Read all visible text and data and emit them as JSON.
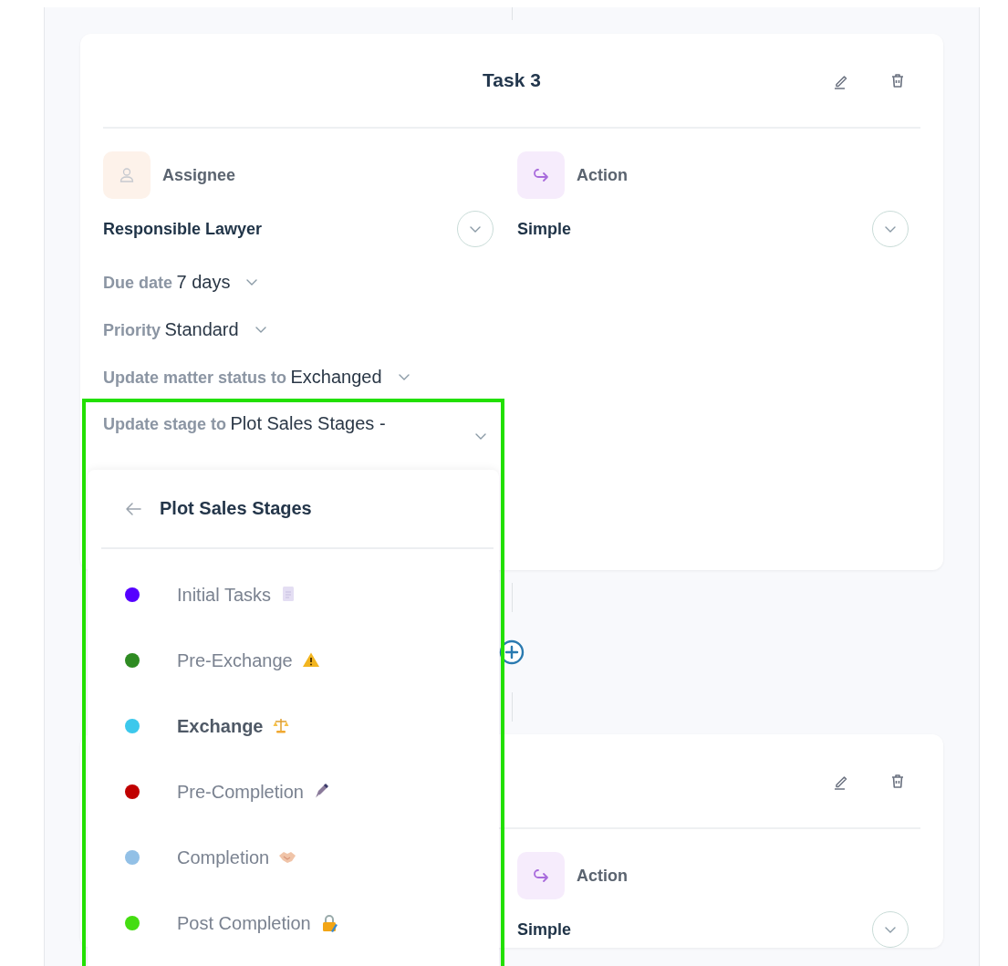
{
  "cards": [
    {
      "title": "Task 3",
      "assignee": {
        "label": "Assignee",
        "value": "Responsible Lawyer"
      },
      "action": {
        "label": "Action",
        "value": "Simple"
      },
      "fields": [
        {
          "label": "Due date",
          "value": "7 days"
        },
        {
          "label": "Priority",
          "value": "Standard"
        },
        {
          "label": "Update matter status to",
          "value": "Exchanged"
        },
        {
          "label": "Update stage to",
          "value": "Plot Sales Stages -"
        }
      ]
    },
    {
      "action": {
        "label": "Action",
        "value": "Simple"
      }
    }
  ],
  "stage_menu": {
    "title": "Plot Sales Stages",
    "items": [
      {
        "label": "Initial Tasks",
        "color": "#5500ff",
        "selected": false
      },
      {
        "label": "Pre-Exchange",
        "color": "#2e8b22",
        "selected": false
      },
      {
        "label": "Exchange",
        "color": "#3cc8ec",
        "selected": true
      },
      {
        "label": "Pre-Completion",
        "color": "#c00000",
        "selected": false
      },
      {
        "label": "Completion",
        "color": "#92c0e6",
        "selected": false
      },
      {
        "label": "Post Completion",
        "color": "#44dd11",
        "selected": false
      }
    ]
  }
}
